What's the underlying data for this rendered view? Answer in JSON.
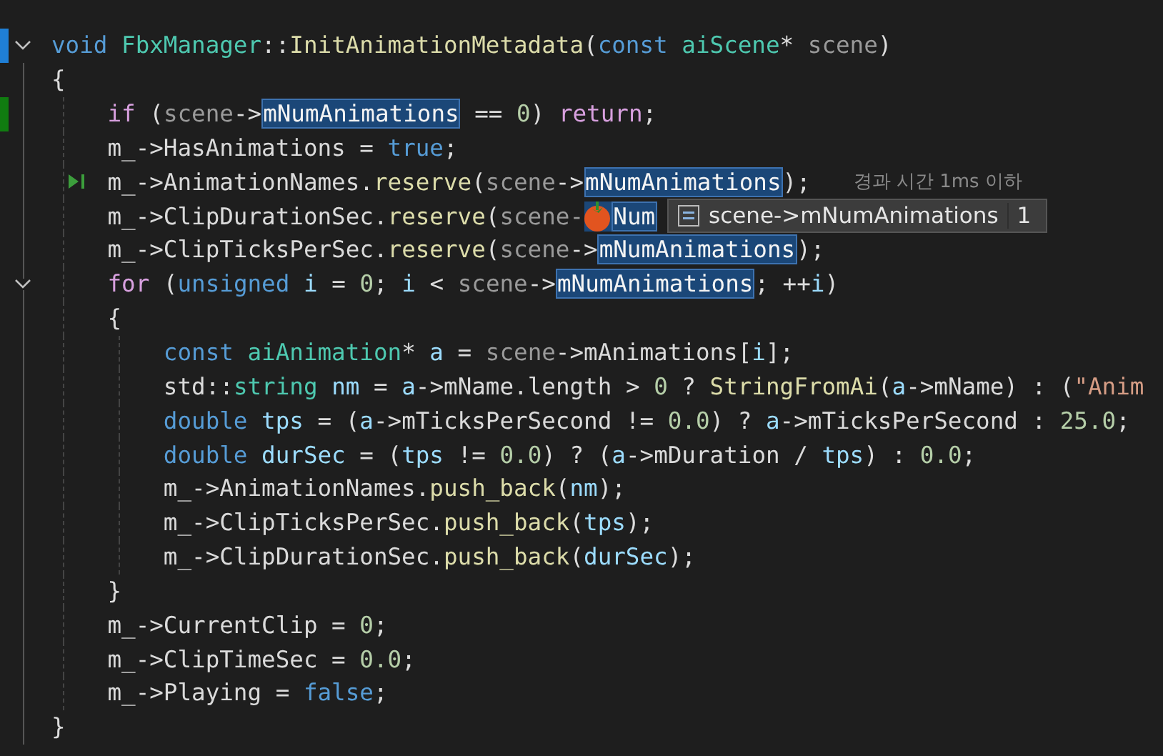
{
  "lines": [
    {
      "change": {
        "color": "#1f7fd6"
      },
      "fold": true,
      "tokens": [
        {
          "t": "void ",
          "color": "#569cd6"
        },
        {
          "t": "FbxManager",
          "color": "#4ec9b0"
        },
        {
          "t": "::",
          "color": "#dcdcdc"
        },
        {
          "t": "InitAnimationMetadata",
          "color": "#dcdcaa"
        },
        {
          "t": "(",
          "color": "#dcdcdc"
        },
        {
          "t": "const ",
          "color": "#569cd6"
        },
        {
          "t": "aiScene",
          "color": "#4ec9b0"
        },
        {
          "t": "* ",
          "color": "#dcdcdc"
        },
        {
          "t": "scene",
          "color": "#9a9a9a"
        },
        {
          "t": ")",
          "color": "#dcdcdc"
        }
      ]
    },
    {
      "tokens": [
        {
          "t": "{",
          "color": "#dcdcdc"
        }
      ]
    },
    {
      "change": {
        "color": "#107c10"
      },
      "tokens": [
        {
          "t": "    if",
          "color": "#d8a0df"
        },
        {
          "t": " (",
          "color": "#dcdcdc"
        },
        {
          "t": "scene",
          "color": "#9a9a9a"
        },
        {
          "t": "->",
          "color": "#dcdcdc"
        },
        {
          "t": "mNumAnimations",
          "hl": true
        },
        {
          "t": " == ",
          "color": "#dcdcdc"
        },
        {
          "t": "0",
          "color": "#b5cea8"
        },
        {
          "t": ") ",
          "color": "#dcdcdc"
        },
        {
          "t": "return",
          "color": "#d8a0df"
        },
        {
          "t": ";",
          "color": "#dcdcdc"
        }
      ]
    },
    {
      "tokens": [
        {
          "t": "    m_->HasAnimations = ",
          "color": "#dadada"
        },
        {
          "t": "true",
          "color": "#569cd6"
        },
        {
          "t": ";",
          "color": "#dcdcdc"
        }
      ]
    },
    {
      "current": true,
      "hint": "경과 시간 1ms 이하",
      "tokens": [
        {
          "t": "    m_->AnimationNames.",
          "color": "#dadada"
        },
        {
          "t": "reserve",
          "color": "#dcdcaa"
        },
        {
          "t": "(",
          "color": "#dcdcdc"
        },
        {
          "t": "scene",
          "color": "#9a9a9a"
        },
        {
          "t": "->",
          "color": "#dcdcdc"
        },
        {
          "t": "mNumAnimations",
          "hl": true
        },
        {
          "t": ");",
          "color": "#dcdcdc"
        }
      ]
    },
    {
      "tooltip": {
        "expression": "scene->mNumAnimations",
        "value": "1"
      },
      "tokens": [
        {
          "t": "    m_->ClipDurationSec.",
          "color": "#dadada"
        },
        {
          "t": "reserve",
          "color": "#dcdcaa"
        },
        {
          "t": "(",
          "color": "#dcdcdc"
        },
        {
          "t": "scene-",
          "color": "#9a9a9a"
        },
        {
          "t": "Num",
          "hl": true,
          "covered": true
        }
      ]
    },
    {
      "tokens": [
        {
          "t": "    m_->ClipTicksPerSec.",
          "color": "#dadada"
        },
        {
          "t": "reserve",
          "color": "#dcdcaa"
        },
        {
          "t": "(",
          "color": "#dcdcdc"
        },
        {
          "t": "scene",
          "color": "#9a9a9a"
        },
        {
          "t": "->",
          "color": "#dcdcdc"
        },
        {
          "t": "mNumAnimations",
          "hl": true
        },
        {
          "t": ");",
          "color": "#dcdcdc"
        }
      ]
    },
    {
      "fold": true,
      "tokens": [
        {
          "t": "    for",
          "color": "#d8a0df"
        },
        {
          "t": " (",
          "color": "#dcdcdc"
        },
        {
          "t": "unsigned",
          "color": "#569cd6"
        },
        {
          "t": " i",
          "color": "#9cdcfe"
        },
        {
          "t": " = ",
          "color": "#dcdcdc"
        },
        {
          "t": "0",
          "color": "#b5cea8"
        },
        {
          "t": "; ",
          "color": "#dcdcdc"
        },
        {
          "t": "i",
          "color": "#9cdcfe"
        },
        {
          "t": " < ",
          "color": "#dcdcdc"
        },
        {
          "t": "scene",
          "color": "#9a9a9a"
        },
        {
          "t": "->",
          "color": "#dcdcdc"
        },
        {
          "t": "mNumAnimations",
          "hl": true
        },
        {
          "t": "; ++",
          "color": "#dcdcdc"
        },
        {
          "t": "i",
          "color": "#9cdcfe"
        },
        {
          "t": ")",
          "color": "#dcdcdc"
        }
      ]
    },
    {
      "tokens": [
        {
          "t": "    {",
          "color": "#dcdcdc"
        }
      ]
    },
    {
      "tokens": [
        {
          "t": "        const ",
          "color": "#569cd6"
        },
        {
          "t": "aiAnimation",
          "color": "#4ec9b0"
        },
        {
          "t": "* ",
          "color": "#dcdcdc"
        },
        {
          "t": "a",
          "color": "#9cdcfe"
        },
        {
          "t": " = ",
          "color": "#dcdcdc"
        },
        {
          "t": "scene",
          "color": "#9a9a9a"
        },
        {
          "t": "->mAnimations[",
          "color": "#dadada"
        },
        {
          "t": "i",
          "color": "#9cdcfe"
        },
        {
          "t": "];",
          "color": "#dcdcdc"
        }
      ]
    },
    {
      "tokens": [
        {
          "t": "        std::",
          "color": "#dadada"
        },
        {
          "t": "string",
          "color": "#4ec9b0"
        },
        {
          "t": " nm",
          "color": "#9cdcfe"
        },
        {
          "t": " = ",
          "color": "#dcdcdc"
        },
        {
          "t": "a",
          "color": "#9cdcfe"
        },
        {
          "t": "->mName.length > ",
          "color": "#dadada"
        },
        {
          "t": "0",
          "color": "#b5cea8"
        },
        {
          "t": " ? ",
          "color": "#dcdcdc"
        },
        {
          "t": "StringFromAi",
          "color": "#dcdcaa"
        },
        {
          "t": "(",
          "color": "#dcdcdc"
        },
        {
          "t": "a",
          "color": "#9cdcfe"
        },
        {
          "t": "->mName) : (",
          "color": "#dadada"
        },
        {
          "t": "\"Anim",
          "color": "#d69d85"
        }
      ]
    },
    {
      "tokens": [
        {
          "t": "        double",
          "color": "#569cd6"
        },
        {
          "t": " tps",
          "color": "#9cdcfe"
        },
        {
          "t": " = (",
          "color": "#dcdcdc"
        },
        {
          "t": "a",
          "color": "#9cdcfe"
        },
        {
          "t": "->mTicksPerSecond != ",
          "color": "#dadada"
        },
        {
          "t": "0.0",
          "color": "#b5cea8"
        },
        {
          "t": ") ? ",
          "color": "#dcdcdc"
        },
        {
          "t": "a",
          "color": "#9cdcfe"
        },
        {
          "t": "->mTicksPerSecond : ",
          "color": "#dadada"
        },
        {
          "t": "25.0",
          "color": "#b5cea8"
        },
        {
          "t": ";",
          "color": "#dcdcdc"
        }
      ]
    },
    {
      "tokens": [
        {
          "t": "        double",
          "color": "#569cd6"
        },
        {
          "t": " durSec",
          "color": "#9cdcfe"
        },
        {
          "t": " = (",
          "color": "#dcdcdc"
        },
        {
          "t": "tps",
          "color": "#9cdcfe"
        },
        {
          "t": " != ",
          "color": "#dcdcdc"
        },
        {
          "t": "0.0",
          "color": "#b5cea8"
        },
        {
          "t": ") ? (",
          "color": "#dcdcdc"
        },
        {
          "t": "a",
          "color": "#9cdcfe"
        },
        {
          "t": "->mDuration / ",
          "color": "#dadada"
        },
        {
          "t": "tps",
          "color": "#9cdcfe"
        },
        {
          "t": ") : ",
          "color": "#dcdcdc"
        },
        {
          "t": "0.0",
          "color": "#b5cea8"
        },
        {
          "t": ";",
          "color": "#dcdcdc"
        }
      ]
    },
    {
      "tokens": [
        {
          "t": "        m_->AnimationNames.",
          "color": "#dadada"
        },
        {
          "t": "push_back",
          "color": "#dcdcaa"
        },
        {
          "t": "(",
          "color": "#dcdcdc"
        },
        {
          "t": "nm",
          "color": "#9cdcfe"
        },
        {
          "t": ");",
          "color": "#dcdcdc"
        }
      ]
    },
    {
      "tokens": [
        {
          "t": "        m_->ClipTicksPerSec.",
          "color": "#dadada"
        },
        {
          "t": "push_back",
          "color": "#dcdcaa"
        },
        {
          "t": "(",
          "color": "#dcdcdc"
        },
        {
          "t": "tps",
          "color": "#9cdcfe"
        },
        {
          "t": ");",
          "color": "#dcdcdc"
        }
      ]
    },
    {
      "tokens": [
        {
          "t": "        m_->ClipDurationSec.",
          "color": "#dadada"
        },
        {
          "t": "push_back",
          "color": "#dcdcaa"
        },
        {
          "t": "(",
          "color": "#dcdcdc"
        },
        {
          "t": "durSec",
          "color": "#9cdcfe"
        },
        {
          "t": ");",
          "color": "#dcdcdc"
        }
      ]
    },
    {
      "tokens": [
        {
          "t": "    }",
          "color": "#dcdcdc"
        }
      ]
    },
    {
      "tokens": [
        {
          "t": "    m_->CurrentClip = ",
          "color": "#dadada"
        },
        {
          "t": "0",
          "color": "#b5cea8"
        },
        {
          "t": ";",
          "color": "#dcdcdc"
        }
      ]
    },
    {
      "tokens": [
        {
          "t": "    m_->ClipTimeSec = ",
          "color": "#dadada"
        },
        {
          "t": "0.0",
          "color": "#b5cea8"
        },
        {
          "t": ";",
          "color": "#dcdcdc"
        }
      ]
    },
    {
      "tokens": [
        {
          "t": "    m_->Playing = ",
          "color": "#dadada"
        },
        {
          "t": "false",
          "color": "#569cd6"
        },
        {
          "t": ";",
          "color": "#dcdcdc"
        }
      ]
    },
    {
      "tokens": [
        {
          "t": "}",
          "color": "#dcdcdc"
        }
      ]
    }
  ]
}
